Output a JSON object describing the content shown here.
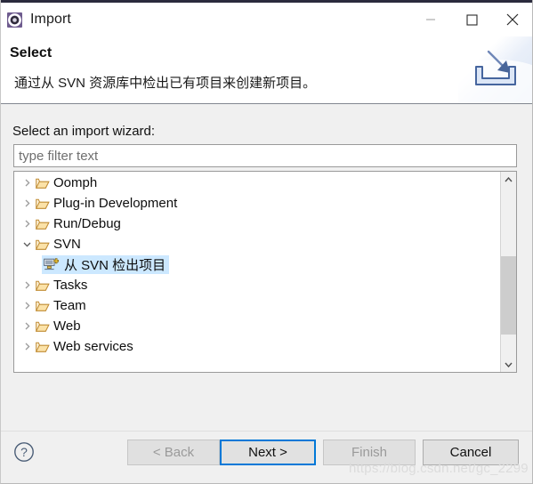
{
  "window": {
    "title": "Import",
    "icon": "eclipse-wizard-icon",
    "controls": {
      "minimize": "minimize-icon",
      "maximize": "maximize-icon",
      "close": "close-icon"
    }
  },
  "header": {
    "title": "Select",
    "description": "通过从 SVN 资源库中检出已有项目来创建新项目。",
    "banner_icon": "import-banner-icon"
  },
  "main": {
    "field_label": "Select an import wizard:",
    "filter": {
      "value": "",
      "placeholder": "type filter text"
    },
    "tree": [
      {
        "label": "Oomph",
        "icon": "folder-icon",
        "expanded": false,
        "level": 0,
        "selected": false
      },
      {
        "label": "Plug-in Development",
        "icon": "folder-icon",
        "expanded": false,
        "level": 0,
        "selected": false
      },
      {
        "label": "Run/Debug",
        "icon": "folder-icon",
        "expanded": false,
        "level": 0,
        "selected": false
      },
      {
        "label": "SVN",
        "icon": "folder-icon",
        "expanded": true,
        "level": 0,
        "selected": false
      },
      {
        "label": "从 SVN 检出项目",
        "icon": "svn-checkout-icon",
        "leaf": true,
        "level": 1,
        "selected": true
      },
      {
        "label": "Tasks",
        "icon": "folder-icon",
        "expanded": false,
        "level": 0,
        "selected": false
      },
      {
        "label": "Team",
        "icon": "folder-icon",
        "expanded": false,
        "level": 0,
        "selected": false
      },
      {
        "label": "Web",
        "icon": "folder-icon",
        "expanded": false,
        "level": 0,
        "selected": false
      },
      {
        "label": "Web services",
        "icon": "folder-icon",
        "expanded": false,
        "level": 0,
        "selected": false
      }
    ],
    "scrollbar": {
      "up_icon": "chevron-up-icon",
      "down_icon": "chevron-down-icon"
    }
  },
  "footer": {
    "help_icon": "help-icon",
    "buttons": {
      "back": {
        "label": "< Back",
        "enabled": false,
        "default": false
      },
      "next": {
        "label": "Next >",
        "enabled": true,
        "default": true
      },
      "finish": {
        "label": "Finish",
        "enabled": false,
        "default": false
      },
      "cancel": {
        "label": "Cancel",
        "enabled": true,
        "default": false
      }
    }
  },
  "watermark": "https://blog.csdn.net/gc_2299",
  "colors": {
    "accent": "#0078d7",
    "selection": "#cce8ff",
    "title_icon": "#6e5b8e",
    "body_bg": "#f0f0f0"
  }
}
